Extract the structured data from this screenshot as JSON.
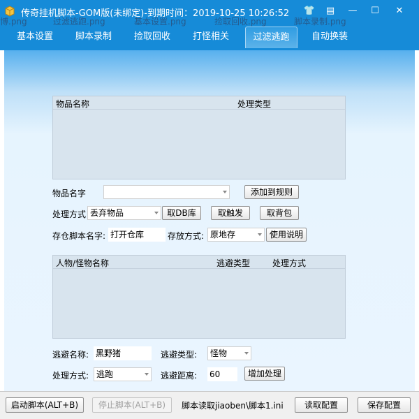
{
  "window": {
    "title": "传奇挂机脚本-GOM版(未绑定)-到期时间：2019-10-25 10:26:52",
    "controls": {
      "skin": "👕",
      "menu": "▤",
      "minimize": "—",
      "maximize": "☐",
      "close": "✕"
    }
  },
  "ghost_tabs": [
    "博.png",
    "过滤逃跑.png",
    "基本设置.png",
    "捡取回收.png",
    "脚本录制.png"
  ],
  "tabs": [
    {
      "label": "基本设置"
    },
    {
      "label": "脚本录制"
    },
    {
      "label": "捡取回收"
    },
    {
      "label": "打怪相关"
    },
    {
      "label": "过滤逃跑",
      "active": true
    },
    {
      "label": "自动换装"
    }
  ],
  "items_table": {
    "headers": [
      "物品名称",
      "处理类型"
    ],
    "rows": []
  },
  "item_form": {
    "name_label": "物品名字",
    "name_value": "",
    "add_rule_button": "添加到规则",
    "method_label": "处理方式",
    "method_value": "丢弃物品",
    "db_button": "取DB库",
    "trigger_button": "取触发",
    "bag_button": "取背包",
    "store_script_label": "存仓脚本名字:",
    "store_script_value": "打开仓库",
    "store_mode_label": "存放方式:",
    "store_mode_value": "原地存",
    "help_button": "使用说明"
  },
  "monster_table": {
    "headers": [
      "人物/怪物名称",
      "逃避类型",
      "处理方式"
    ],
    "rows": []
  },
  "escape_form": {
    "name_label": "逃避名称:",
    "name_value": "黑野猪",
    "type_label": "逃避类型:",
    "type_value": "怪物",
    "method_label": "处理方式:",
    "method_value": "逃跑",
    "distance_label": "逃避距离:",
    "distance_value": "60",
    "add_button": "增加处理"
  },
  "statusbar": {
    "start_button": "启动脚本(ALT+B)",
    "stop_button": "停止脚本(ALT+B)",
    "script_path": "脚本读取jiaoben\\脚本1.ini",
    "load_button": "读取配置",
    "save_button": "保存配置"
  },
  "colors": {
    "titlebar": "#168bd8",
    "accent": "#2f9ce2"
  }
}
